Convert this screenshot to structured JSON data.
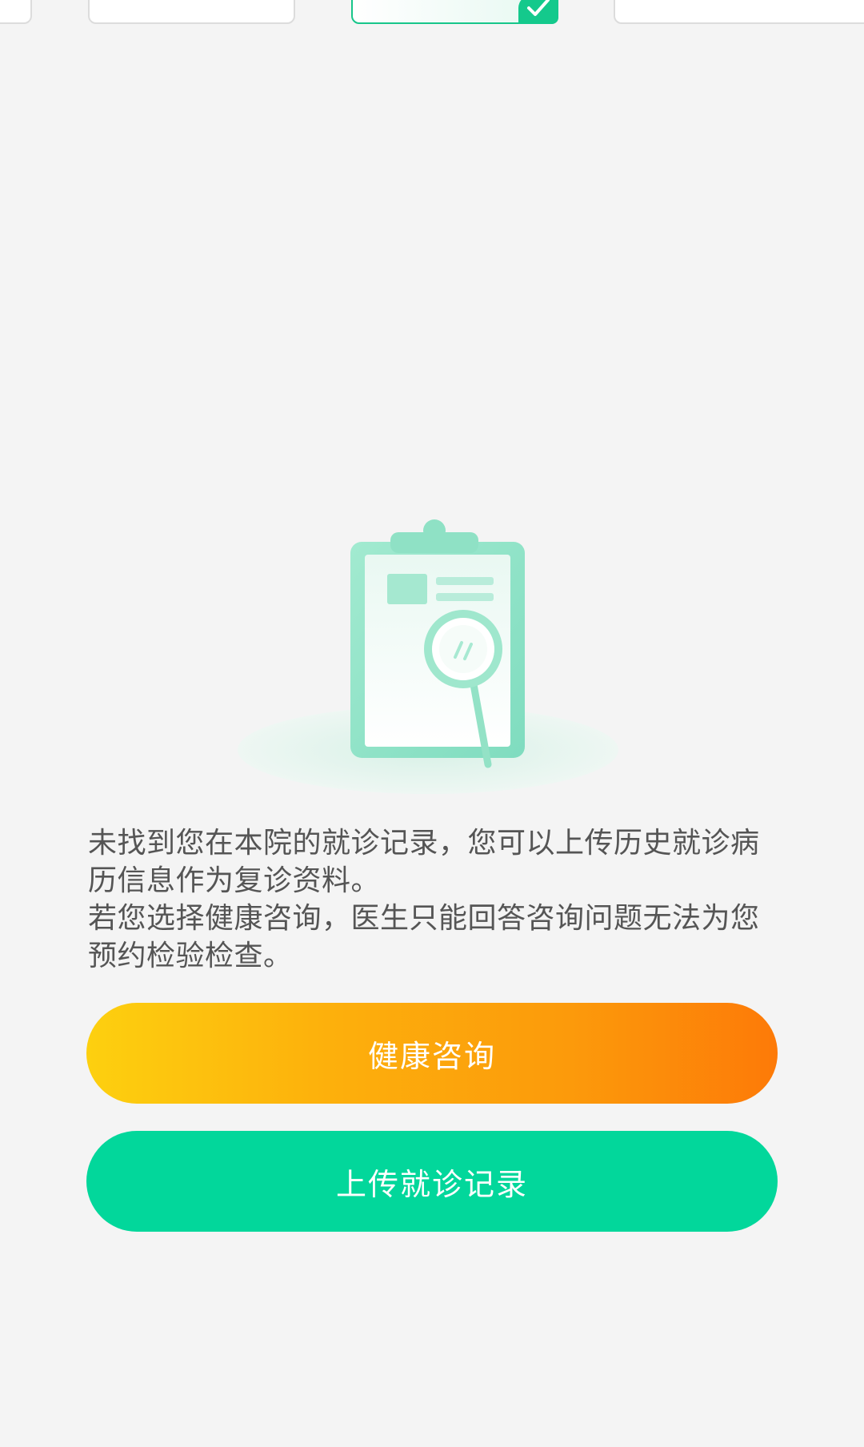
{
  "message": {
    "line1": "未找到您在本院的就诊记录，您可以上传历史就诊病历信息作为复诊资料。",
    "line2": "若您选择健康咨询，医生只能回答咨询问题无法为您预约检验检查。"
  },
  "buttons": {
    "consult_label": "健康咨询",
    "upload_label": "上传就诊记录"
  },
  "colors": {
    "accent_green": "#02d79b",
    "orange_start": "#fdd00f",
    "orange_end": "#fd7a08"
  },
  "icons": {
    "empty_state": "clipboard-search-icon",
    "selected": "check-icon"
  }
}
